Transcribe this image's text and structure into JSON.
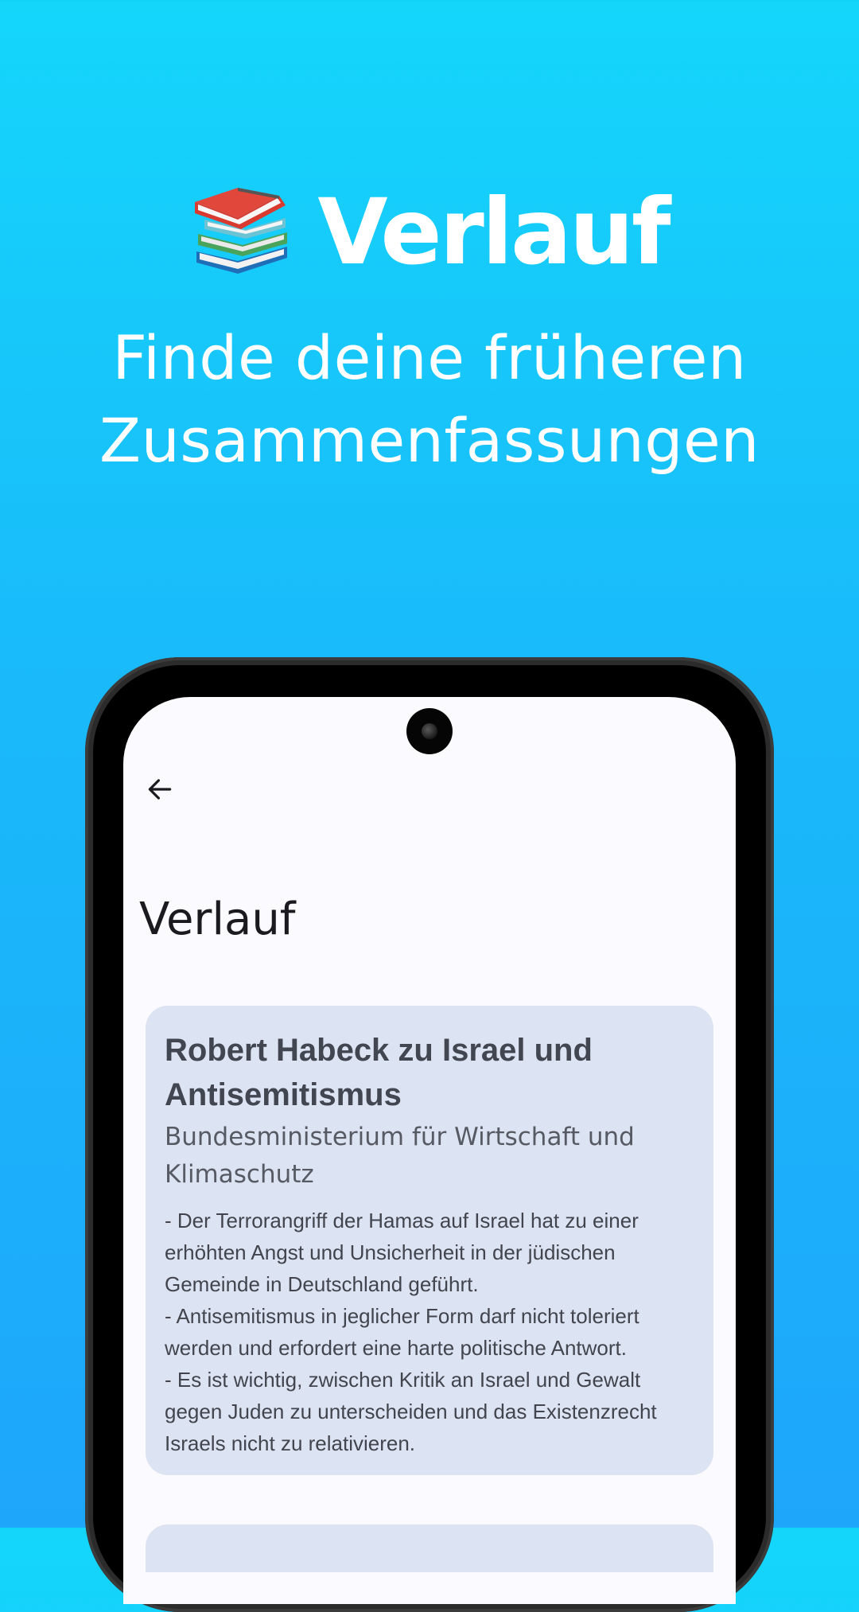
{
  "hero": {
    "icon": "books-icon",
    "title": "Verlauf",
    "subtitle_lines": [
      "Finde deine früheren",
      "Zusammenfassungen"
    ]
  },
  "app": {
    "back_icon": "arrow-back-icon",
    "screen_title": "Verlauf",
    "history": [
      {
        "title_lines": [
          "Robert Habeck zu Israel und",
          "Antisemitismus"
        ],
        "source_lines": [
          "Bundesministerium für Wirtschaft und",
          "Klimaschutz"
        ],
        "summary_lines": [
          "- Der Terrorangriff der Hamas auf Israel hat zu einer",
          "erhöhten Angst und Unsicherheit in der jüdischen",
          "Gemeinde in Deutschland geführt.",
          "- Antisemitismus in jeglicher Form darf nicht toleriert",
          "werden und erfordert eine harte politische Antwort.",
          "- Es ist wichtig, zwischen Kritik an Israel und Gewalt",
          "gegen Juden zu unterscheiden und das Existenzrecht",
          "Israels nicht zu relativieren."
        ]
      }
    ]
  },
  "colors": {
    "background_top": "#14d6fb",
    "background_bottom": "#1ea6fb",
    "card": "#dce3f2",
    "screen": "#fbfaff"
  }
}
